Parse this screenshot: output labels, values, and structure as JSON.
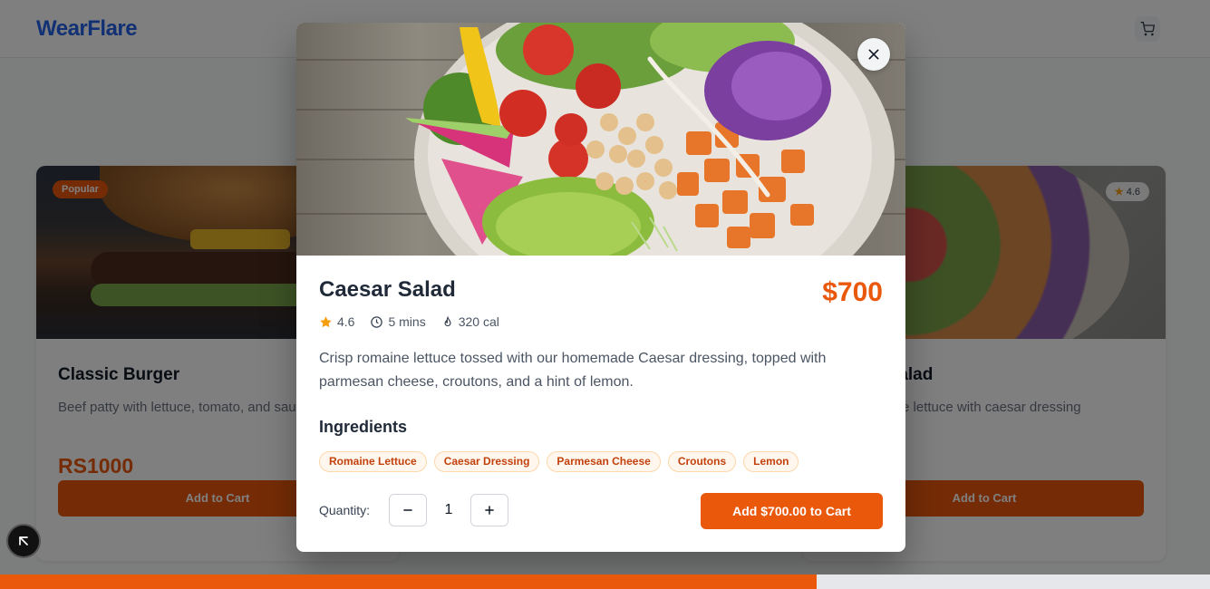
{
  "background": {
    "logo": "WearFlare",
    "cards": [
      {
        "badge": "Popular",
        "title": "Classic Burger",
        "description": "Beef patty with lettuce, tomato, and sauce",
        "price": "RS1000",
        "button": "Add to Cart"
      },
      {
        "rating": "4.6",
        "title": "Caesar Salad",
        "description": "Crisp romaine lettuce with caesar dressing",
        "button": "Add to Cart"
      }
    ]
  },
  "modal": {
    "title": "Caesar Salad",
    "price": "$700",
    "rating": "4.6",
    "time": "5 mins",
    "calories": "320 cal",
    "description": "Crisp romaine lettuce tossed with our homemade Caesar dressing, topped with parmesan cheese, croutons, and a hint of lemon.",
    "ingredients_heading": "Ingredients",
    "ingredients": [
      "Romaine Lettuce",
      "Caesar Dressing",
      "Parmesan Cheese",
      "Croutons",
      "Lemon"
    ],
    "quantity_label": "Quantity:",
    "quantity": "1",
    "add_button": "Add $700.00 to Cart"
  },
  "progress": {
    "fraction": 0.675
  },
  "colors": {
    "accent": "#ea580c",
    "chip_bg": "#fff7ed",
    "chip_text": "#c2410c",
    "star": "#f59e0b"
  },
  "icons": {
    "close": "close-icon",
    "rating": "star-icon",
    "time": "clock-icon",
    "calories": "flame-icon",
    "minus": "minus-icon",
    "plus": "plus-icon",
    "cart": "cart-icon",
    "cursor": "cursor-icon"
  }
}
